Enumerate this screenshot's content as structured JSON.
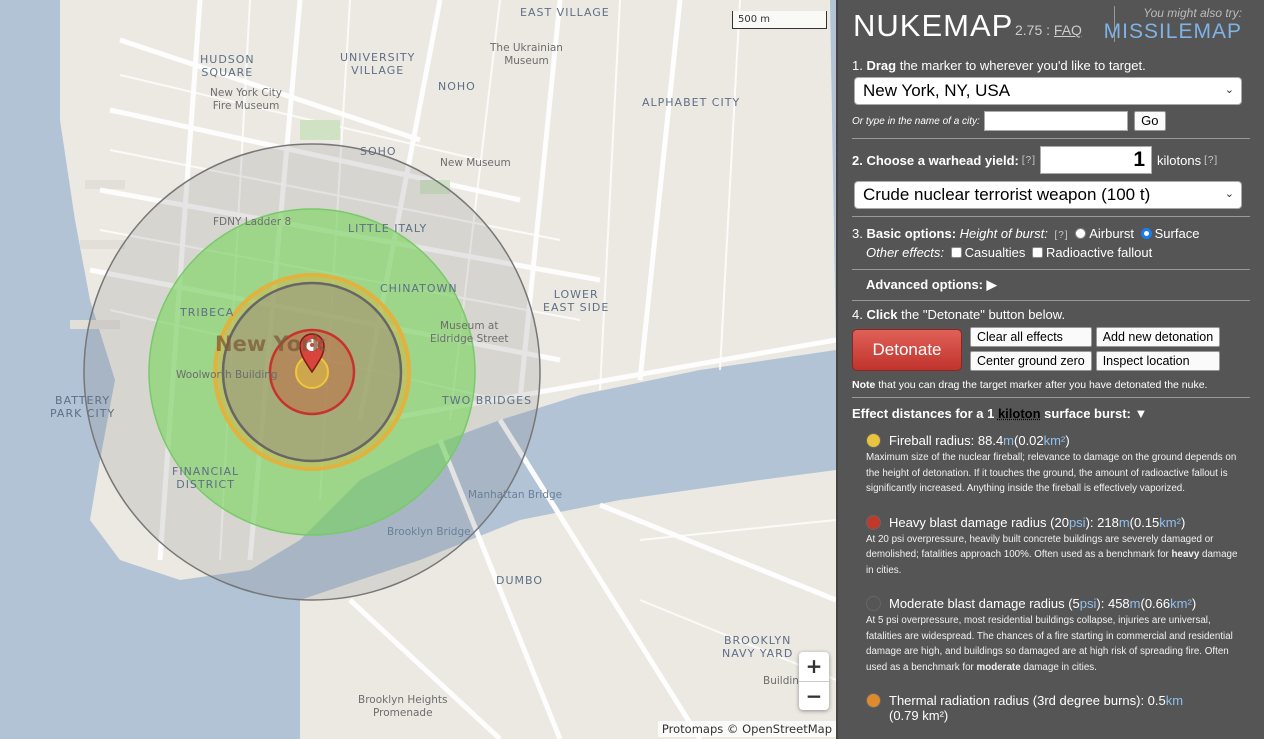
{
  "map": {
    "scale_label": "500 m",
    "attribution": "Protomaps © OpenStreetMap",
    "zoom_in": "+",
    "zoom_out": "−",
    "labels": {
      "east_village": "EAST VILLAGE",
      "hudson_square": "HUDSON\nSQUARE",
      "university_village": "UNIVERSITY\nVILLAGE",
      "ukrainian_museum": "The Ukrainian\nMuseum",
      "noho": "NOHO",
      "alphabet_city": "ALPHABET CITY",
      "nyc_fire_museum": "New York City\nFire Museum",
      "soho": "SOHO",
      "new_museum": "New Museum",
      "fdny": "FDNY Ladder 8",
      "little_italy": "LITTLE ITALY",
      "chinatown": "CHINATOWN",
      "lower_east_side": "LOWER\nEAST SIDE",
      "tribeca": "TRIBECA",
      "new_york": "New York",
      "museum_eldridge": "Museum at\nEldridge Street",
      "woolworth": "Woolworth Building",
      "battery_park": "BATTERY\nPARK CITY",
      "two_bridges": "TWO BRIDGES",
      "financial_district": "FINANCIAL\nDISTRICT",
      "manhattan_bridge": "Manhattan Bridge",
      "brooklyn_bridge": "Brooklyn Bridge",
      "dumbo": "DUMBO",
      "brooklyn_navy_yard": "BROOKLYN\nNAVY YARD",
      "building": "Buildin",
      "brooklyn_heights": "Brooklyn Heights\nPromenade"
    }
  },
  "panel": {
    "brand": "NUKEMAP",
    "version": "2.75 : ",
    "faq": "FAQ",
    "also_try": "You might also try:",
    "missilemap": "MISSILEMAP",
    "step1_num": "1. ",
    "step1_bold": "Drag",
    "step1_rest": " the marker to wherever you'd like to target.",
    "city_selected": "New York, NY, USA",
    "city_prompt": "Or type in the name of a city:",
    "city_input_value": "",
    "go": "Go",
    "step2_label": "2. Choose a warhead yield:",
    "hint": "[?]",
    "yield_value": "1",
    "kilotons": "kilotons",
    "preset_selected": "Crude nuclear terrorist weapon (100 t)",
    "step3_num": "3. ",
    "step3_bold": "Basic options:",
    "height_label": "Height of burst:",
    "airburst": "Airburst",
    "surface": "Surface",
    "other_effects": "Other effects:",
    "casualties": "Casualties",
    "fallout": "Radioactive fallout",
    "advanced": "Advanced options: ▶",
    "step4_num": "4. ",
    "step4_bold": "Click",
    "step4_rest": " the \"Detonate\" button below.",
    "detonate": "Detonate",
    "clear_all": "Clear all effects",
    "add_new": "Add new detonation",
    "center_gz": "Center ground zero",
    "inspect": "Inspect location",
    "note_bold": "Note",
    "note_rest": " that you can drag the target marker after you have detonated the nuke.",
    "effects_prefix": "Effect distances for a 1 ",
    "effects_kt": "kiloton",
    "effects_suffix": " surface burst: ▼",
    "colors": {
      "fireball": "#e8c340",
      "heavy": "#c0392b",
      "moderate": "#555555",
      "thermal": "#e08a2e"
    },
    "effects": {
      "fireball": {
        "label": "Fireball radius: 88.4 ",
        "m": "m",
        "mid": " (0.02 ",
        "km": "km²",
        "end": ")",
        "desc": "Maximum size of the nuclear fireball; relevance to damage on the ground depends on the height of detonation. If it touches the ground, the amount of radioactive fallout is significantly increased. Anything inside the fireball is effectively vaporized."
      },
      "heavy": {
        "label": "Heavy blast damage radius (20 ",
        "psi": "psi",
        "mid": "): 218 ",
        "m": "m",
        "mid2": " (0.15 ",
        "km": "km²",
        "end": ")",
        "desc_a": "At 20 psi overpressure, heavily built concrete buildings are severely damaged or demolished; fatalities approach 100%. Often used as a benchmark for ",
        "desc_bold": "heavy",
        "desc_b": " damage in cities."
      },
      "moderate": {
        "label": "Moderate blast damage radius (5 ",
        "psi": "psi",
        "mid": "): 458 ",
        "m": "m",
        "mid2": " (0.66 ",
        "km": "km²",
        "end": ")",
        "desc_a": "At 5 psi overpressure, most residential buildings collapse, injuries are universal, fatalities are widespread. The chances of a fire starting in commercial and residential damage are high, and buildings so damaged are at high risk of spreading fire. Often used as a benchmark for ",
        "desc_bold": "moderate",
        "desc_b": " damage in cities."
      },
      "thermal": {
        "label": "Thermal radiation radius (3rd degree burns): 0.5 ",
        "km": "km",
        "line2": "(0.79 km²)"
      }
    }
  }
}
